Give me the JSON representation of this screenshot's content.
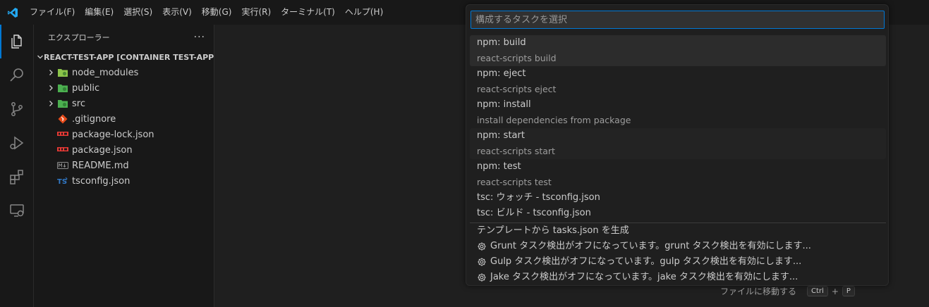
{
  "menu": [
    "ファイル(F)",
    "編集(E)",
    "選択(S)",
    "表示(V)",
    "移動(G)",
    "実行(R)",
    "ターミナル(T)",
    "ヘルプ(H)"
  ],
  "activity_icons": [
    "explorer-icon",
    "search-icon",
    "source-control-icon",
    "run-debug-icon",
    "extensions-icon",
    "remote-explorer-icon"
  ],
  "sidebar": {
    "title": "エクスプローラー",
    "more": "···",
    "workspace": "REACT-TEST-APP [CONTAINER TEST-APP (...",
    "items": [
      {
        "label": "node_modules",
        "type": "folder",
        "icon": "node-folder-icon",
        "color": "#8bc34a"
      },
      {
        "label": "public",
        "type": "folder",
        "icon": "public-folder-icon",
        "color": "#4caf50"
      },
      {
        "label": "src",
        "type": "folder",
        "icon": "src-folder-icon",
        "color": "#4caf50"
      },
      {
        "label": ".gitignore",
        "type": "file",
        "icon": "git-icon",
        "color": "#e64a19"
      },
      {
        "label": "package-lock.json",
        "type": "file",
        "icon": "npm-icon",
        "color": "#e53935"
      },
      {
        "label": "package.json",
        "type": "file",
        "icon": "npm-icon",
        "color": "#e53935"
      },
      {
        "label": "README.md",
        "type": "file",
        "icon": "markdown-icon",
        "color": "#8d8d8d"
      },
      {
        "label": "tsconfig.json",
        "type": "file",
        "icon": "typescript-config-icon",
        "color": "#3178c6"
      }
    ]
  },
  "quickpick": {
    "placeholder": "構成するタスクを選択",
    "tasks": [
      {
        "label": "npm: build",
        "desc": "react-scripts build"
      },
      {
        "label": "npm: eject",
        "desc": "react-scripts eject"
      },
      {
        "label": "npm: install",
        "desc": "install dependencies from package"
      },
      {
        "label": "npm: start",
        "desc": "react-scripts start"
      },
      {
        "label": "npm: test",
        "desc": "react-scripts test"
      }
    ],
    "tsc": [
      "tsc: ウォッチ - tsconfig.json",
      "tsc: ビルド - tsconfig.json"
    ],
    "template": "テンプレートから tasks.json を生成",
    "detections": [
      "Grunt タスク検出がオフになっています。grunt タスク検出を有効にします...",
      "Gulp タスク検出がオフになっています。gulp タスク検出を有効にします...",
      "Jake タスク検出がオフになっています。jake タスク検出を有効にします..."
    ]
  },
  "editor": {
    "goto_label": "ファイルに移動する",
    "keys": [
      "Ctrl",
      "+",
      "P"
    ]
  },
  "colors": {
    "accent": "#0078d4",
    "vscode_blue": "#23a9f2"
  }
}
